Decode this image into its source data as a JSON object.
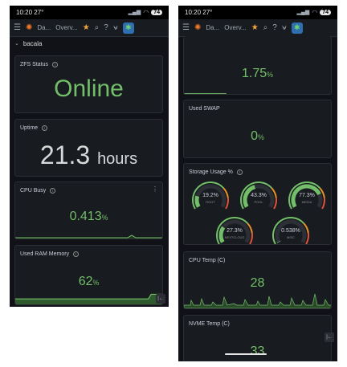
{
  "status_bar": {
    "time": "10:20",
    "indicator": "27°",
    "battery": "74"
  },
  "topbar": {
    "crumb1": "Da...",
    "crumb2": "Overv..."
  },
  "left": {
    "row_title": "bacala",
    "zfs": {
      "title": "ZFS Status",
      "value": "Online"
    },
    "uptime": {
      "title": "Uptime",
      "value": "21.3",
      "unit": "hours"
    },
    "cpu_busy": {
      "title": "CPU Busy",
      "value": "0.413",
      "unit": "%"
    },
    "ram": {
      "title": "Used RAM Memory",
      "value": "62",
      "unit": "%"
    }
  },
  "right": {
    "top_value": {
      "value": "1.75",
      "unit": "%"
    },
    "swap": {
      "title": "Used SWAP",
      "value": "0",
      "unit": "%"
    },
    "storage": {
      "title": "Storage Usage %",
      "gauges": [
        {
          "value": "19.2%",
          "label": "ROOT",
          "fraction": 0.192
        },
        {
          "value": "43.3%",
          "label": "POOL",
          "fraction": 0.433
        },
        {
          "value": "77.3%",
          "label": "MEDIA",
          "fraction": 0.773
        },
        {
          "value": "27.3%",
          "label": "NEXTCLOUD",
          "fraction": 0.273
        },
        {
          "value": "0.538%",
          "label": "MISC",
          "fraction": 0.00538
        }
      ]
    },
    "cpu_temp": {
      "title": "CPU Temp (C)",
      "value": "28"
    },
    "nvme_temp": {
      "title": "NVME Temp (C)",
      "value": "33"
    }
  },
  "colors": {
    "green": "#73bf69",
    "gauge_track": "#2c2f36",
    "gauge_red": "#e0523a",
    "gauge_orange": "#e9902a"
  }
}
